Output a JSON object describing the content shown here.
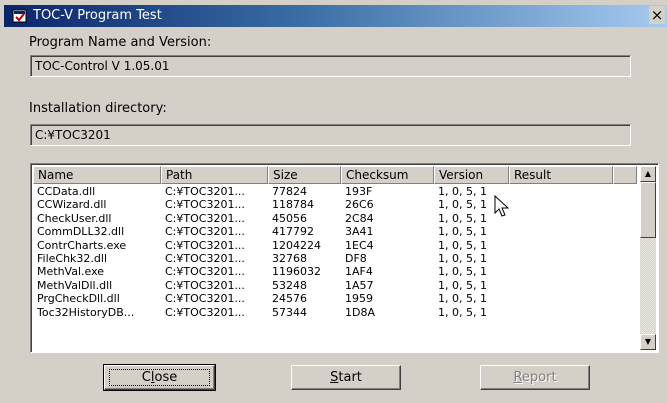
{
  "window": {
    "title": "TOC-V Program Test",
    "close_glyph": "×"
  },
  "program": {
    "label": "Program Name and Version:",
    "value": "TOC-Control V 1.05.01"
  },
  "install": {
    "label": "Installation directory:",
    "value": "C:¥TOC3201"
  },
  "table": {
    "columns": [
      "Name",
      "Path",
      "Size",
      "Checksum",
      "Version",
      "Result"
    ],
    "rows": [
      [
        "CCData.dll",
        "C:¥TOC3201...",
        "77824",
        "193F",
        "1, 0, 5, 1",
        ""
      ],
      [
        "CCWizard.dll",
        "C:¥TOC3201...",
        "118784",
        "26C6",
        "1, 0, 5, 1",
        ""
      ],
      [
        "CheckUser.dll",
        "C:¥TOC3201...",
        "45056",
        "2C84",
        "1, 0, 5, 1",
        ""
      ],
      [
        "CommDLL32.dll",
        "C:¥TOC3201...",
        "417792",
        "3A41",
        "1, 0, 5, 1",
        ""
      ],
      [
        "ContrCharts.exe",
        "C:¥TOC3201...",
        "1204224",
        "1EC4",
        "1, 0, 5, 1",
        ""
      ],
      [
        "FileChk32.dll",
        "C:¥TOC3201...",
        "32768",
        "DF8",
        "1, 0, 5, 1",
        ""
      ],
      [
        "MethVal.exe",
        "C:¥TOC3201...",
        "1196032",
        "1AF4",
        "1, 0, 5, 1",
        ""
      ],
      [
        "MethValDll.dll",
        "C:¥TOC3201...",
        "53248",
        "1A57",
        "1, 0, 5, 1",
        ""
      ],
      [
        "PrgCheckDll.dll",
        "C:¥TOC3201...",
        "24576",
        "1959",
        "1, 0, 5, 1",
        ""
      ],
      [
        "Toc32HistoryDB...",
        "C:¥TOC3201...",
        "57344",
        "1D8A",
        "1, 0, 5, 1",
        ""
      ]
    ]
  },
  "buttons": {
    "close": {
      "pre": "C",
      "accel": "l",
      "post": "ose"
    },
    "start": {
      "pre": "",
      "accel": "S",
      "post": "tart"
    },
    "report": {
      "pre": "",
      "accel": "R",
      "post": "eport"
    }
  },
  "icons": {
    "app": "app-icon",
    "scroll_up": "arrow-up-icon",
    "scroll_down": "arrow-down-icon",
    "cursor": "mouse-pointer-icon"
  },
  "colors": {
    "title_start": "#0a246a",
    "title_end": "#a6caf0",
    "face": "#d4d0c8"
  }
}
